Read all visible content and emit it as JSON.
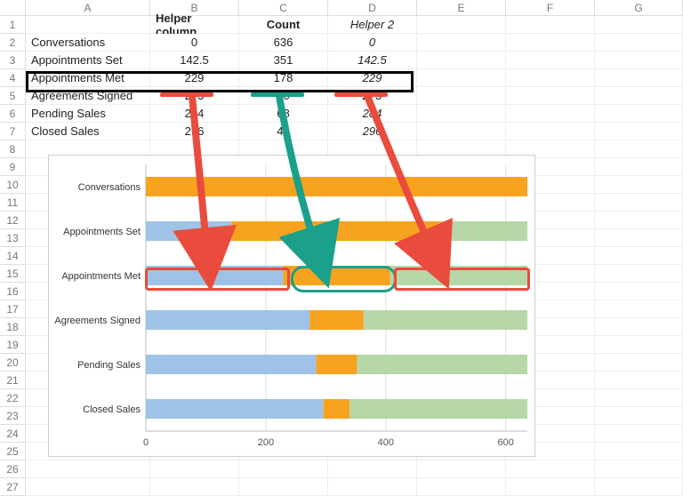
{
  "columns": [
    "A",
    "B",
    "C",
    "D",
    "E",
    "F",
    "G"
  ],
  "row_count": 27,
  "headers": {
    "B": "Helper column",
    "C": "Count",
    "D": "Helper 2"
  },
  "table": {
    "rows": [
      {
        "label": "Conversations",
        "helper": "0",
        "count": "636",
        "helper2": "0"
      },
      {
        "label": "Appointments Set",
        "helper": "142.5",
        "count": "351",
        "helper2": "142.5"
      },
      {
        "label": "Appointments Met",
        "helper": "229",
        "count": "178",
        "helper2": "229"
      },
      {
        "label": "Agreements Signed",
        "helper": "273",
        "count": "90",
        "helper2": "273"
      },
      {
        "label": "Pending Sales",
        "helper": "284",
        "count": "68",
        "helper2": "284"
      },
      {
        "label": "Closed Sales",
        "helper": "296",
        "count": "44",
        "helper2": "296"
      }
    ]
  },
  "chart_data": {
    "type": "bar",
    "orientation": "horizontal",
    "stacked": true,
    "categories": [
      "Conversations",
      "Appointments Set",
      "Appointments Met",
      "Agreements Signed",
      "Pending Sales",
      "Closed Sales"
    ],
    "series": [
      {
        "name": "Helper column",
        "color": "#9ec3e6",
        "values": [
          0,
          142.5,
          229,
          273,
          284,
          296
        ]
      },
      {
        "name": "Count",
        "color": "#f8a31f",
        "values": [
          636,
          351,
          178,
          90,
          68,
          44
        ]
      },
      {
        "name": "Helper 2",
        "color": "#b6d7a8",
        "values": [
          0,
          142.5,
          229,
          273,
          284,
          296
        ]
      }
    ],
    "xlim": [
      0,
      636
    ],
    "xticks": [
      0,
      200,
      400,
      600
    ],
    "title": "",
    "xlabel": "",
    "ylabel": ""
  },
  "colors": {
    "orange": "#f8a31f",
    "blue": "#9ec3e6",
    "green": "#b6d7a8",
    "red_ann": "#e94b3c",
    "teal_ann": "#1aa08b"
  }
}
